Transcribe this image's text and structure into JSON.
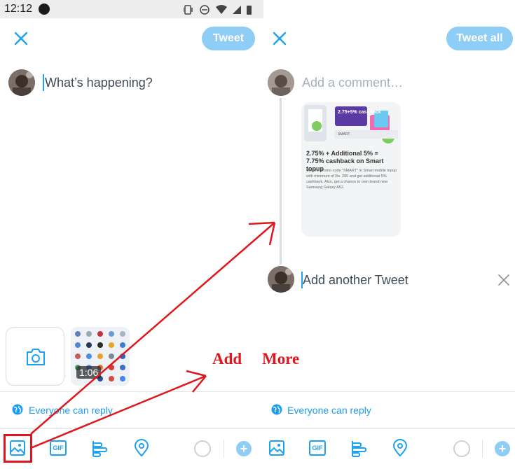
{
  "status_bar": {
    "time": "12:12"
  },
  "left_panel": {
    "tweet_button": "Tweet",
    "compose_placeholder": "What’s happening?",
    "video_duration": "1:06",
    "reply_setting": "Everyone can reply"
  },
  "right_panel": {
    "tweet_all_button": "Tweet all",
    "comment_placeholder": "Add a comment…",
    "card": {
      "title": "2.75% + Additional 5% = 7.75% cashback on Smart topup",
      "description": "Use the promo code \"SMART\" in Smart mobile topup with minimum of Rs. 200 and get additional 5% cashback. Also, get a chance to own brand new Samsung Galaxy A52.",
      "image_text": "2.75+5% cashback",
      "brand": "SMART"
    },
    "another_tweet_placeholder": "Add another Tweet",
    "reply_setting": "Everyone can reply"
  },
  "toolbar": {
    "icons": [
      "image-icon",
      "gif-icon",
      "poll-icon",
      "location-icon",
      "progress-circle",
      "add-icon"
    ],
    "gif_label": "GIF"
  },
  "annotation": {
    "word1": "Add",
    "word2": "More",
    "color": "#e0161c"
  },
  "colors": {
    "accent": "#1da1f2",
    "button_disabled": "#8ecdf5",
    "annotation_red": "#e0161c"
  }
}
